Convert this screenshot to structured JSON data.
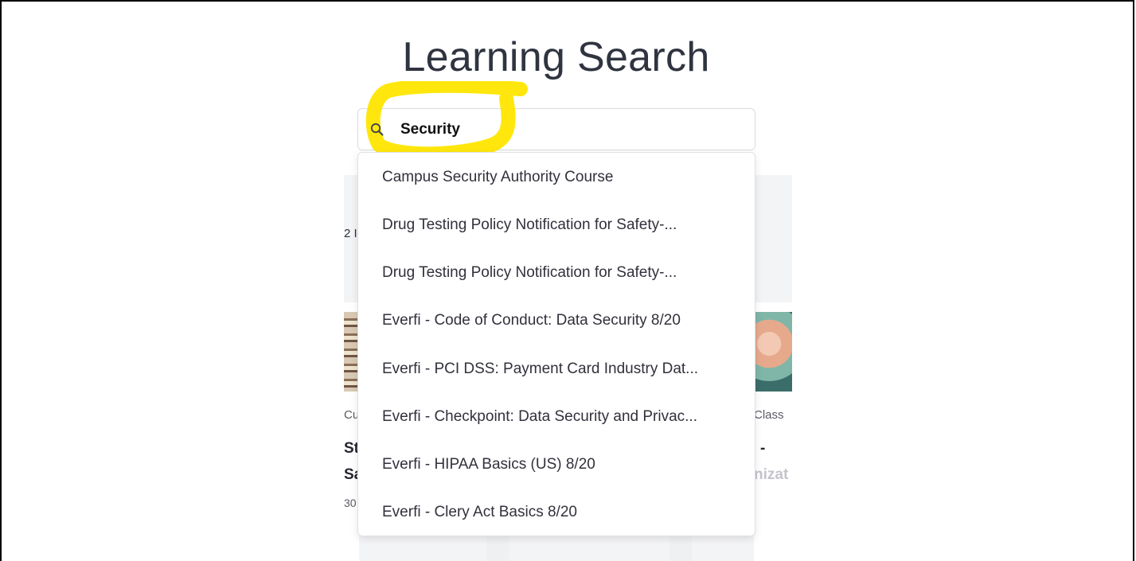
{
  "page": {
    "title": "Learning Search"
  },
  "search": {
    "value": "Security",
    "placeholder": ""
  },
  "suggestions": [
    {
      "label": "Campus Security Authority Course"
    },
    {
      "label": "Drug Testing Policy Notification for Safety-..."
    },
    {
      "label": "Drug Testing Policy Notification for Safety-..."
    },
    {
      "label": "Everfi - Code of Conduct: Data Security 8/20"
    },
    {
      "label": "Everfi - PCI DSS: Payment Card Industry Dat..."
    },
    {
      "label": "Everfi - Checkpoint: Data Security and Privac..."
    },
    {
      "label": "Everfi - HIPAA Basics (US) 8/20"
    },
    {
      "label": "Everfi - Clery Act Basics 8/20"
    }
  ],
  "background": {
    "left_count_fragment": "2 I",
    "left_type_fragment": "Cu",
    "left_title_line1": "St",
    "left_title_line2": "Sa",
    "left_meta_fragment": "30",
    "right_type_fragment": "Class",
    "right_title_line1": "-",
    "right_title_line2": "nizat"
  },
  "colors": {
    "highlighter": "#ffe600",
    "title": "#2f3440",
    "panel_bg": "#f3f4f6"
  },
  "icons": {
    "search": "magnifier"
  }
}
